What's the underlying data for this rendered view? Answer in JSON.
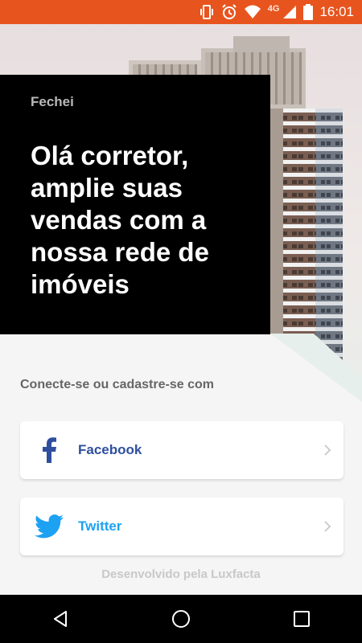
{
  "status_bar": {
    "time": "16:01",
    "network": "4G",
    "icons": [
      "vibrate-icon",
      "alarm-icon",
      "wifi-icon",
      "signal-icon",
      "battery-icon"
    ],
    "color": "#e8541e"
  },
  "hero": {
    "brand": "Fechei",
    "headline": "Olá corretor, amplie suas vendas com a nossa rede de imóveis"
  },
  "login": {
    "prompt": "Conecte-se ou cadastre-se com",
    "facebook_label": "Facebook",
    "twitter_label": "Twitter",
    "facebook_color": "#2f4f9e",
    "twitter_color": "#1da1f2"
  },
  "footer": {
    "text": "Desenvolvido pela Luxfacta"
  },
  "nav_bar": {
    "icons": [
      "back-icon",
      "home-icon",
      "recents-icon"
    ]
  }
}
